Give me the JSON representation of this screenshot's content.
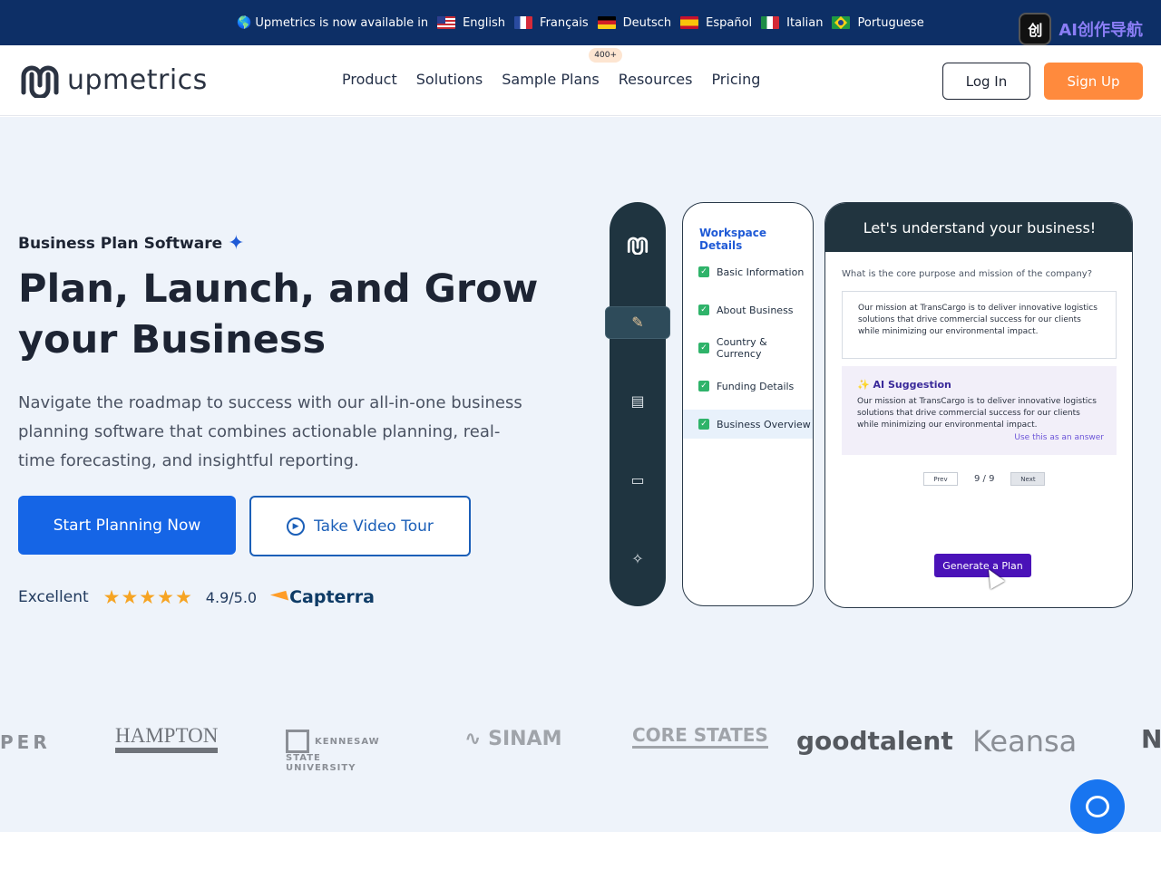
{
  "topbar": {
    "announce": "Upmetrics is now available in",
    "languages": [
      "English",
      "Français",
      "Deutsch",
      "Español",
      "Italian",
      "Portuguese"
    ]
  },
  "badge": {
    "glyph": "创",
    "text": "AI创作导航"
  },
  "header": {
    "logo_text": "upmetrics",
    "nav": [
      "Product",
      "Solutions",
      "Sample Plans",
      "Resources",
      "Pricing"
    ],
    "sample_pill": "400+",
    "login": "Log In",
    "signup": "Sign Up"
  },
  "hero": {
    "eyebrow": "Business Plan Software",
    "title": "Plan, Launch, and Grow your Business",
    "lead": "Navigate the roadmap to success with our all-in-one business planning software that combines actionable planning, real-time forecasting, and insightful reporting.",
    "cta_primary": "Start Planning Now",
    "cta_secondary": "Take Video Tour",
    "rating_label": "Excellent",
    "rating_stars": "★★★★★",
    "rating_score": "4.9/5.0",
    "rating_source": "Capterra"
  },
  "mockup": {
    "workspace_title": "Workspace Details",
    "steps": [
      "Basic Information",
      "About Business",
      "Country & Currency",
      "Funding Details",
      "Business Overview"
    ],
    "panel_title": "Let's understand your business!",
    "question": "What is the core purpose and mission of the company?",
    "answer": "Our mission at TransCargo is to deliver innovative logistics solutions that drive commercial success for our clients while minimizing our environmental impact.",
    "suggestion_title": "AI Suggestion",
    "suggestion_text": "Our mission at TransCargo is to deliver innovative logistics solutions that drive commercial success for our clients while minimizing our environmental impact.",
    "use_answer": "Use this as an answer",
    "prev": "Prev",
    "counter": "9 / 9",
    "next": "Next",
    "generate": "Generate a Plan"
  },
  "logos": [
    "PER",
    "HAMPTON",
    "KENNESAW STATE UNIVERSITY",
    "SINAM",
    "CORE STATES",
    "goodtalent",
    "Keansa",
    "N"
  ]
}
